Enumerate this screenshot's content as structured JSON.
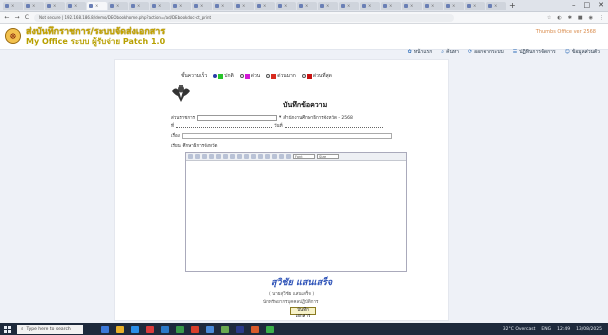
{
  "browser": {
    "tabs": [
      {
        "label": "",
        "active": false
      },
      {
        "label": "",
        "active": false
      },
      {
        "label": "",
        "active": false
      },
      {
        "label": "",
        "active": false
      },
      {
        "label": "",
        "active": true
      },
      {
        "label": "",
        "active": false
      },
      {
        "label": "",
        "active": false
      },
      {
        "label": "",
        "active": false
      },
      {
        "label": "",
        "active": false
      },
      {
        "label": "",
        "active": false
      },
      {
        "label": "",
        "active": false
      },
      {
        "label": "",
        "active": false
      },
      {
        "label": "",
        "active": false
      },
      {
        "label": "",
        "active": false
      },
      {
        "label": "",
        "active": false
      },
      {
        "label": "",
        "active": false
      },
      {
        "label": "",
        "active": false
      },
      {
        "label": "",
        "active": false
      },
      {
        "label": "",
        "active": false
      },
      {
        "label": "",
        "active": false
      },
      {
        "label": "",
        "active": false
      },
      {
        "label": "",
        "active": false
      },
      {
        "label": "",
        "active": false
      },
      {
        "label": "",
        "active": false
      }
    ],
    "new_tab": "+",
    "window_controls": [
      "–",
      "□",
      "✕"
    ],
    "nav": {
      "back": "←",
      "forward": "→",
      "reload": "C"
    },
    "url": "Not secure | 192.168.186.8/demo/DEObookhome.php?action=/ad/DEbookdoc-ct_print",
    "extensions": [
      "☆",
      "◐",
      "✱",
      "■",
      "◉",
      "⋮"
    ]
  },
  "site": {
    "title": "ส่งบันทึกราชการ/ระบบจัดส่งเอกสาร",
    "subtitle": "My Office ระบบ ผู้รับจ่าย Patch 1.0",
    "version": "Thumbs Office ver 2568",
    "logo_glyph": "☸"
  },
  "topnav": [
    {
      "icon": "home-icon",
      "glyph": "✿",
      "label": "หน้าแรก"
    },
    {
      "icon": "search-icon",
      "glyph": "⌕",
      "label": "ค้นหา"
    },
    {
      "icon": "refresh-icon",
      "glyph": "⟳",
      "label": "ออกจากระบบ"
    },
    {
      "icon": "list-icon",
      "glyph": "☰",
      "label": "ปฏิทินการจัดการ"
    },
    {
      "icon": "user-icon",
      "glyph": "☺",
      "label": "ข้อมูลส่วนตัว"
    }
  ],
  "form": {
    "urgency_label": "ชั้นความเร็ว",
    "urgency_options": [
      {
        "label": "ปกติ",
        "color": "#27c42a",
        "checked": true
      },
      {
        "label": "ด่วน",
        "color": "#d21ad6",
        "checked": false
      },
      {
        "label": "ด่วนมาก",
        "color": "#d82a1e",
        "checked": false
      },
      {
        "label": "ด่วนที่สุด",
        "color": "#c81212",
        "checked": false
      }
    ],
    "garuda_glyph": "♛",
    "doc_title": "บันทึกข้อความ",
    "agency_label": "ส่วนราชการ",
    "agency_select": "",
    "agency_value": "สำนักงานศึกษาธิการจังหวัด - 2568",
    "ref_label": "ที่",
    "date_label": "วันที่",
    "subject_label": "เรื่อง",
    "to_label": "เรียน",
    "to_value": "ศึกษาธิการจังหวัด",
    "font_select": "Font",
    "size_select": "Size"
  },
  "signature": {
    "signature_text": "สุวิชัย แสนเสร็จ",
    "name": "( นายสุวิชัย แสนเสร็จ )",
    "position": "นักทรัพยากรบุคคลปฏิบัติการ",
    "save_label": "บันทึกเอกสาร"
  },
  "taskbar": {
    "search_placeholder": "Type here to search",
    "apps": [
      {
        "color": "#3b78d8"
      },
      {
        "color": "#e8b02a"
      },
      {
        "color": "#2a8ee8"
      },
      {
        "color": "#d93c3c"
      },
      {
        "color": "#2a78c8"
      },
      {
        "color": "#3a9a4a"
      },
      {
        "color": "#d8402a"
      },
      {
        "color": "#4a8ad8"
      },
      {
        "color": "#6aa84f"
      },
      {
        "color": "#2a3a8a"
      },
      {
        "color": "#d85a2a"
      },
      {
        "color": "#3bb04a"
      }
    ],
    "weather": "32°C Overcast",
    "lang": "ENG",
    "time": "12:49",
    "date": "13/08/2025"
  }
}
